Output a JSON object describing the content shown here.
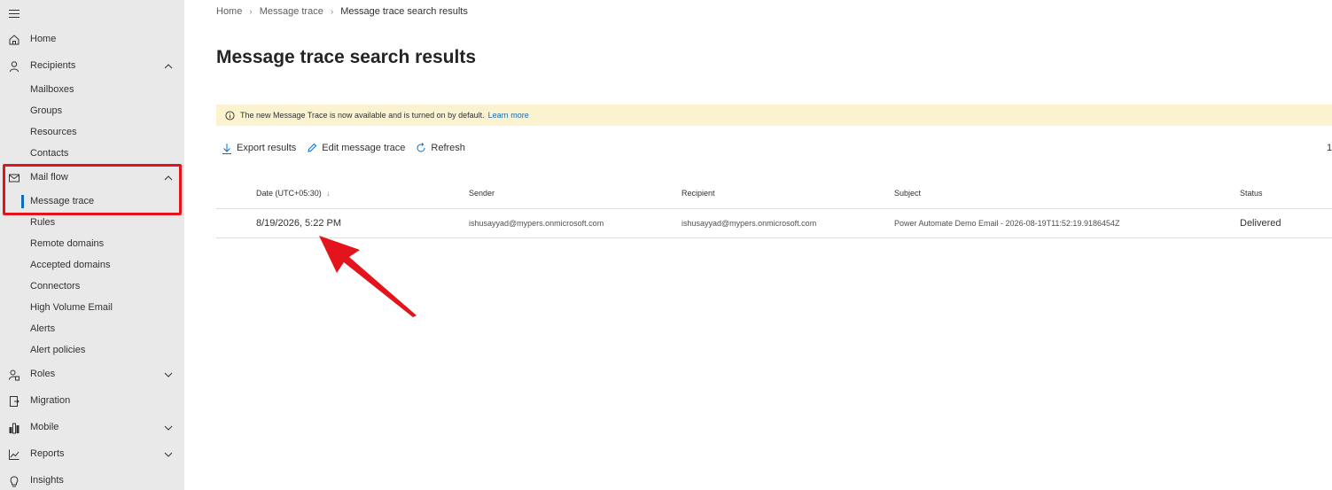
{
  "sidebar": {
    "items": [
      {
        "label": "Home",
        "icon": "home-icon"
      },
      {
        "label": "Recipients",
        "icon": "person-icon",
        "expanded": true
      },
      {
        "label": "Mailboxes"
      },
      {
        "label": "Groups"
      },
      {
        "label": "Resources"
      },
      {
        "label": "Contacts"
      },
      {
        "label": "Mail flow",
        "icon": "mail-icon",
        "expanded": true
      },
      {
        "label": "Message trace",
        "active": true
      },
      {
        "label": "Rules"
      },
      {
        "label": "Remote domains"
      },
      {
        "label": "Accepted domains"
      },
      {
        "label": "Connectors"
      },
      {
        "label": "High Volume Email"
      },
      {
        "label": "Alerts"
      },
      {
        "label": "Alert policies"
      },
      {
        "label": "Roles",
        "icon": "roles-icon"
      },
      {
        "label": "Migration",
        "icon": "migration-icon"
      },
      {
        "label": "Mobile",
        "icon": "mobile-icon"
      },
      {
        "label": "Reports",
        "icon": "reports-icon"
      },
      {
        "label": "Insights",
        "icon": "lightbulb-icon"
      }
    ]
  },
  "breadcrumb": {
    "home": "Home",
    "message_trace": "Message trace",
    "current": "Message trace search results"
  },
  "page": {
    "title": "Message trace search results"
  },
  "banner": {
    "text": "The new Message Trace is now available and is turned on by default.",
    "link": "Learn more"
  },
  "toolbar": {
    "export": "Export results",
    "edit": "Edit message trace",
    "refresh": "Refresh",
    "count": "1"
  },
  "table": {
    "headers": {
      "date": "Date (UTC+05:30)",
      "sender": "Sender",
      "recipient": "Recipient",
      "subject": "Subject",
      "status": "Status"
    },
    "rows": [
      {
        "date": "8/19/2026, 5:22 PM",
        "sender": "ishusayyad@mypers.onmicrosoft.com",
        "recipient": "ishusayyad@mypers.onmicrosoft.com",
        "subject": "Power Automate Demo Email - 2026-08-19T11:52:19.9186454Z",
        "status": "Delivered"
      }
    ]
  },
  "colors": {
    "sidebar_bg": "#e9e9e9",
    "accent": "#0f6cbd",
    "banner_bg": "#fbf3d0",
    "annotation_red": "#e3141b"
  }
}
